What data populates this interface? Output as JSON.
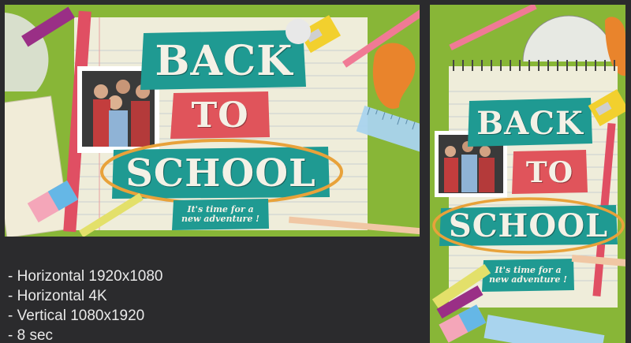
{
  "horizontal_preview": {
    "title_line1": "BACK",
    "title_line2": "TO",
    "title_line3": "SCHOOL",
    "tagline_line1": "It's time for a",
    "tagline_line2": "new adventure !"
  },
  "vertical_preview": {
    "title_line1": "BACK",
    "title_line2": "TO",
    "title_line3": "SCHOOL",
    "tagline_line1": "It's time for a",
    "tagline_line2": "new adventure !"
  },
  "features": [
    "- Horizontal 1920x1080",
    "- Horizontal 4K",
    "- Vertical 1080x1920",
    "- 8 sec"
  ],
  "colors": {
    "background": "#2b2b2d",
    "desk_green": "#8dbb3a",
    "paper": "#efedda",
    "teal_label": "#1f9a92",
    "red_label": "#e0545b",
    "highlight_circle": "#e8a23a"
  }
}
